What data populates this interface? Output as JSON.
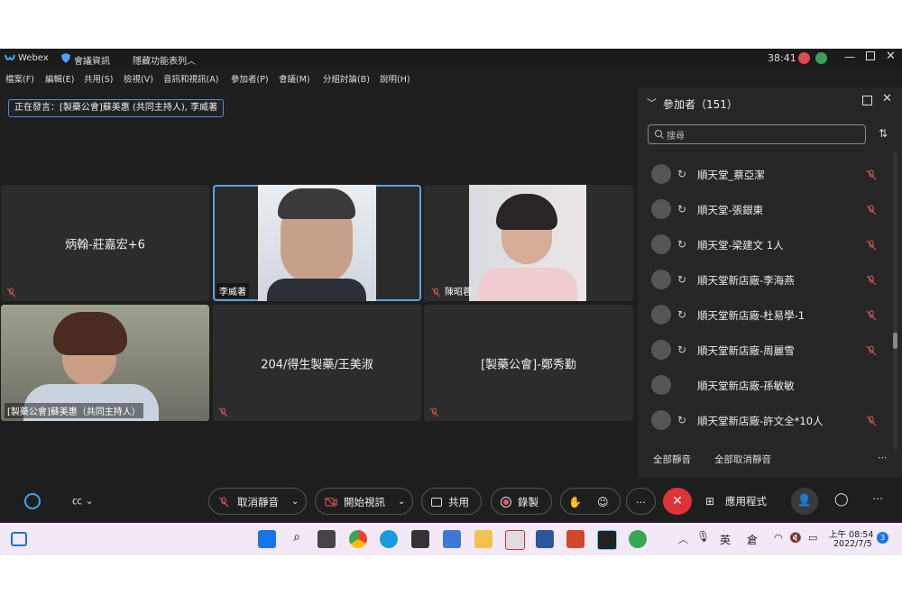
{
  "titlebar": {
    "app_name": "Webex",
    "meeting_info": "會議資訊",
    "hide_menu": "隱藏功能表列",
    "timer": "38:41"
  },
  "menu": [
    "檔案(F)",
    "編輯(E)",
    "共用(S)",
    "檢視(V)",
    "音訊和視訊(A)",
    "參加者(P)",
    "會議(M)",
    "分組討論(B)",
    "說明(H)"
  ],
  "speaking_banner": "正在發言：[製藥公會]蘇美惠 (共同主持人), 李威著",
  "tiles": {
    "t1": "炳翰-莊嘉宏+6",
    "t2": "李威著",
    "t3": "陳昭蓉",
    "t4": "[製藥公會]蘇美惠（共同主持人）",
    "t5": "204/得生製藥/王美淑",
    "t6": "[製藥公會]-鄭秀勤"
  },
  "participants_panel": {
    "title": "參加者（151）",
    "search_placeholder": "搜尋",
    "rows": [
      "順天堂_蔡亞潔",
      "順天堂-張銀東",
      "順天堂-梁建文 1人",
      "順天堂新店廠-李海燕",
      "順天堂新店廠-杜易學-1",
      "順天堂新店廠-周麗雪",
      "順天堂新店廠-孫敏敏",
      "順天堂新店廠-許文全*10人"
    ],
    "mute_all": "全部靜音",
    "unmute_all": "全部取消靜音"
  },
  "toolbar": {
    "unmute": "取消靜音",
    "start_video": "開始視訊",
    "share": "共用",
    "record": "錄製",
    "apps": "應用程式"
  },
  "taskbar": {
    "lang1": "英",
    "lang2": "倉",
    "time": "上午 08:54",
    "date": "2022/7/5",
    "notif_count": "3"
  },
  "colors": {
    "accent": "#5ea0e8",
    "end_call": "#e0323a",
    "mute_red": "#e05a5a"
  }
}
